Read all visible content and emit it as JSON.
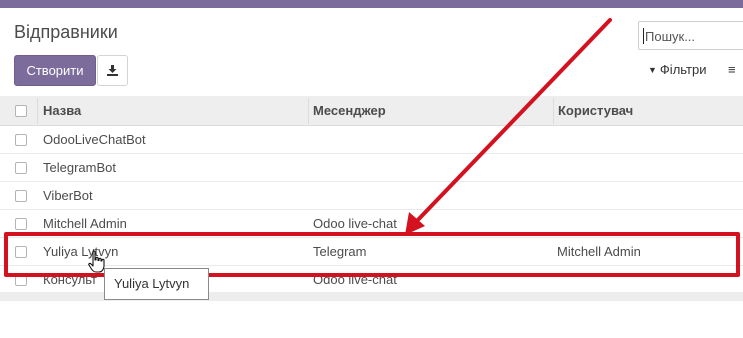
{
  "header": {
    "title": "Відправники",
    "search_placeholder": "Пошук...",
    "create_label": "Створити",
    "filters_label": "Фільтри",
    "groupby_glyph": "≡"
  },
  "table": {
    "columns": [
      "Назва",
      "Месенджер",
      "Користувач"
    ],
    "rows": [
      {
        "name": "OdooLiveChatBot",
        "messenger": "",
        "user": ""
      },
      {
        "name": "TelegramBot",
        "messenger": "",
        "user": ""
      },
      {
        "name": "ViberBot",
        "messenger": "",
        "user": ""
      },
      {
        "name": "Mitchell Admin",
        "messenger": "Odoo live-chat",
        "user": ""
      },
      {
        "name": "Yuliya Lytvyn",
        "messenger": "Telegram",
        "user": "Mitchell Admin"
      },
      {
        "name": "Консульт",
        "messenger": "Odoo live-chat",
        "user": ""
      }
    ]
  },
  "tooltip": "Yuliya Lytvyn",
  "colors": {
    "brand": "#7c6c9c",
    "annotation_red": "#d4121f"
  },
  "icons": {
    "download": "download-icon",
    "filter": "filter-icon",
    "cursor": "hand-pointer-icon",
    "arrow": "annotation-arrow"
  }
}
